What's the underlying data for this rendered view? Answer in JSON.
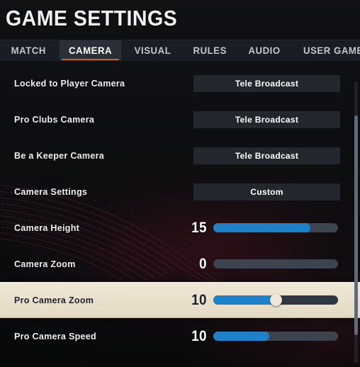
{
  "header": {
    "title": "GAME SETTINGS"
  },
  "tabs": [
    {
      "label": "MATCH",
      "active": false
    },
    {
      "label": "CAMERA",
      "active": true
    },
    {
      "label": "VISUAL",
      "active": false
    },
    {
      "label": "RULES",
      "active": false
    },
    {
      "label": "AUDIO",
      "active": false
    },
    {
      "label": "USER GAMEP",
      "active": false
    }
  ],
  "settings": [
    {
      "label": "Locked to Player Camera",
      "type": "dropdown",
      "value": "Tele Broadcast",
      "selected": false
    },
    {
      "label": "Pro Clubs Camera",
      "type": "dropdown",
      "value": "Tele Broadcast",
      "selected": false
    },
    {
      "label": "Be a Keeper Camera",
      "type": "dropdown",
      "value": "Tele Broadcast",
      "selected": false
    },
    {
      "label": "Camera Settings",
      "type": "dropdown",
      "value": "Custom",
      "selected": false
    },
    {
      "label": "Camera Height",
      "type": "slider",
      "value": "15",
      "fill_percent": 78,
      "knob": false,
      "selected": false
    },
    {
      "label": "Camera Zoom",
      "type": "slider",
      "value": "0",
      "fill_percent": 0,
      "knob": false,
      "selected": false
    },
    {
      "label": "Pro Camera Zoom",
      "type": "slider",
      "value": "10",
      "fill_percent": 50,
      "knob": true,
      "selected": true
    },
    {
      "label": "Pro Camera Speed",
      "type": "slider",
      "value": "10",
      "fill_percent": 45,
      "knob": false,
      "selected": false
    }
  ],
  "scrollbar": {
    "thumb_top_percent": 12,
    "thumb_height_percent": 78
  },
  "colors": {
    "accent_orange": "#c4622d",
    "slider_blue": "#1f82c8",
    "slider_track": "#3c444f",
    "highlight_cream": "#e8dfcc",
    "highlight_text": "#1b2333",
    "panel_dark": "#23262d"
  }
}
